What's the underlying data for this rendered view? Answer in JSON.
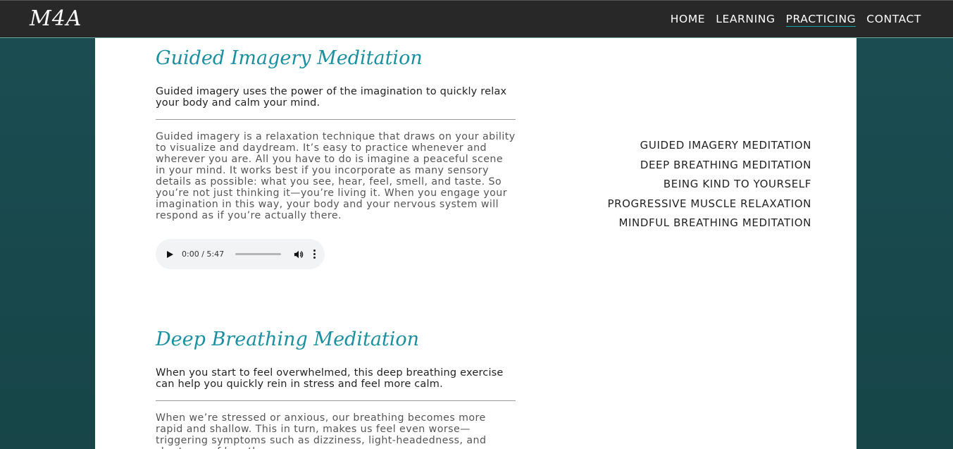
{
  "header": {
    "logo": "M4A",
    "nav": [
      {
        "label": "HOME",
        "active": false
      },
      {
        "label": "LEARNING",
        "active": false
      },
      {
        "label": "PRACTICING",
        "active": true
      },
      {
        "label": "CONTACT",
        "active": false
      }
    ]
  },
  "sections": [
    {
      "title": "Guided Imagery Meditation",
      "lead": "Guided imagery uses the power of the imagination to quickly relax your body and calm your mind.",
      "body": "Guided imagery is a relaxation technique that draws on your ability to visualize and daydream. It’s easy to practice whenever and wherever you are. All you have to do is imagine a peaceful scene in your mind. It works best if you incorporate as many sensory details as possible: what you see, hear, feel, smell, and taste. So you’re not just thinking it—you’re living it. When you engage your imagination in this way, your body and your nervous system will respond as if you’re actually there.",
      "audio": {
        "time": "0:00 / 5:47"
      }
    },
    {
      "title": "Deep Breathing Meditation",
      "lead": "When you start to feel overwhelmed, this deep breathing exercise can help you quickly rein in stress and feel more calm.",
      "body": "When we’re stressed or anxious, our breathing becomes more rapid and shallow. This in turn, makes us feel even worse—triggering symptoms such as dizziness, light-headedness, and shortness of breath."
    }
  ],
  "toc": [
    "GUIDED IMAGERY MEDITATION",
    "DEEP BREATHING MEDITATION",
    "BEING KIND TO YOURSELF",
    "PROGRESSIVE MUSCLE RELAXATION",
    "MINDFUL BREATHING MEDITATION"
  ],
  "colors": {
    "header_bg": "#282828",
    "page_bg": "#1a4d52",
    "heading": "#1b8fa0",
    "active_underline": "#1aa3a8"
  }
}
